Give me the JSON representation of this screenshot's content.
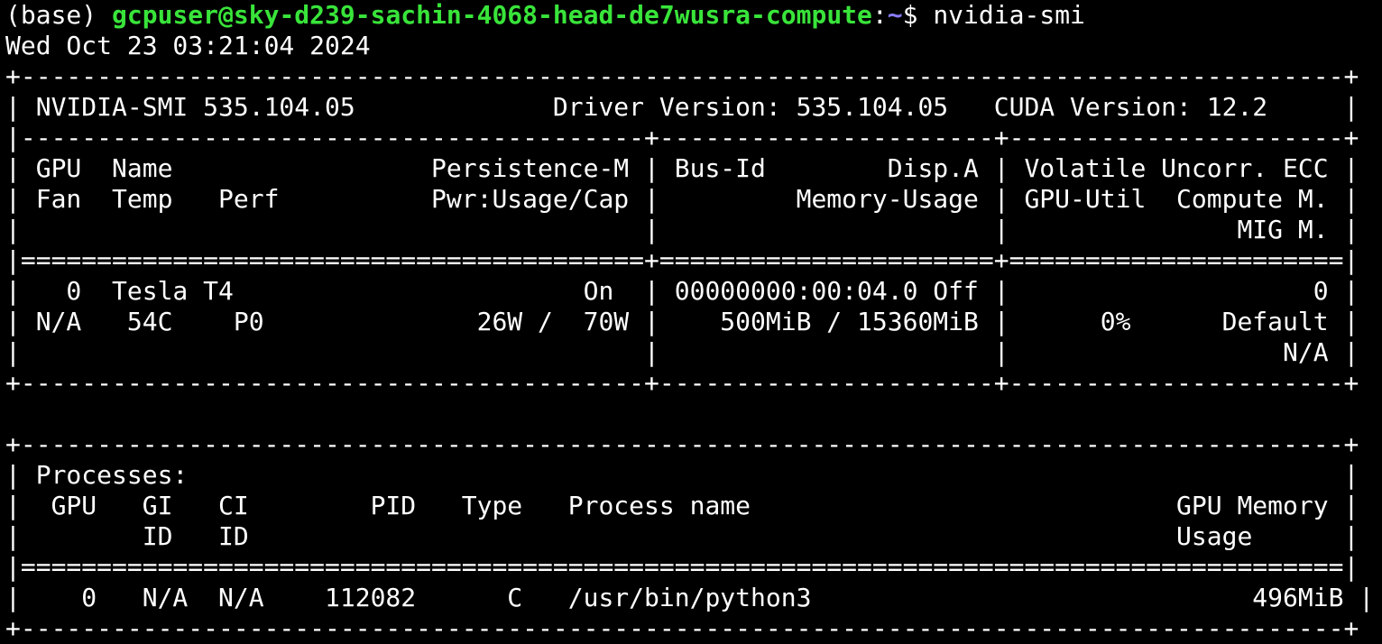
{
  "prompt": {
    "env": "(base) ",
    "user_host": "gcpuser@sky-d239-sachin-4068-head-de7wusra-compute",
    "colon": ":",
    "path": "~",
    "dollar": "$ ",
    "command": "nvidia-smi"
  },
  "timestamp": "Wed Oct 23 03:21:04 2024",
  "colors": {
    "background": "#000000",
    "text": "#ffffff",
    "user_host": "#39e43a",
    "path": "#8a7cff"
  },
  "gpu_table": {
    "border_top": "+---------------------------------------------------------------------------------------+",
    "version_line": "| NVIDIA-SMI 535.104.05             Driver Version: 535.104.05   CUDA Version: 12.2     |",
    "sep_1": "|-----------------------------------------+----------------------+----------------------+",
    "header_1": "| GPU  Name                 Persistence-M | Bus-Id        Disp.A | Volatile Uncorr. ECC |",
    "header_2": "| Fan  Temp   Perf          Pwr:Usage/Cap |         Memory-Usage | GPU-Util  Compute M. |",
    "header_3": "|                                         |                      |               MIG M. |",
    "sep_2": "|=========================================+======================+======================|",
    "row_1": "|   0  Tesla T4                       On  | 00000000:00:04.0 Off |                    0 |",
    "row_2": "| N/A   54C    P0              26W /  70W |    500MiB / 15360MiB |      0%      Default |",
    "row_3": "|                                         |                      |                  N/A |",
    "border_bottom": "+-----------------------------------------+----------------------+----------------------+"
  },
  "process_table": {
    "border_top": "+---------------------------------------------------------------------------------------+",
    "title": "| Processes:                                                                            |",
    "header_1": "|  GPU   GI   CI        PID   Type   Process name                            GPU Memory |",
    "header_2": "|        ID   ID                                                             Usage      |",
    "sep": "|=======================================================================================|",
    "row_1": "|    0   N/A  N/A    112082      C   /usr/bin/python3                             496MiB |",
    "border_bottom": "+---------------------------------------------------------------------------------------+"
  }
}
